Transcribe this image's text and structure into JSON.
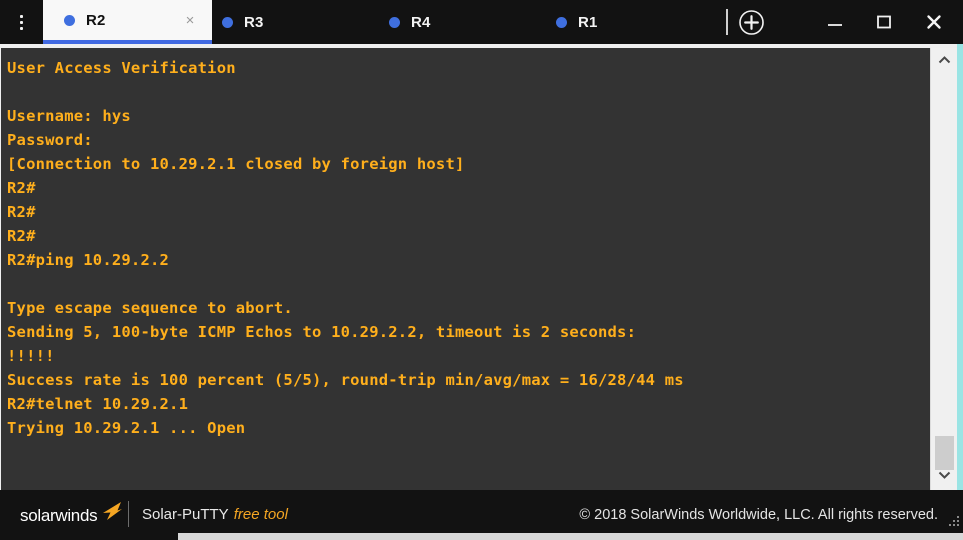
{
  "titlebar": {
    "menu_icon": "kebab-menu-icon",
    "tabs": [
      {
        "label": "R2",
        "active": true,
        "dot_color": "#3f6fdf",
        "close_glyph": "×"
      },
      {
        "label": "R3",
        "active": false,
        "dot_color": "#3f6fdf"
      },
      {
        "label": "R4",
        "active": false,
        "dot_color": "#3f6fdf"
      },
      {
        "label": "R1",
        "active": false,
        "dot_color": "#3f6fdf"
      }
    ],
    "add_tab_icon": "plus-circle-icon",
    "window_controls": {
      "minimize": "minimize-icon",
      "maximize": "maximize-icon",
      "close": "close-icon"
    }
  },
  "terminal": {
    "background": "#333333",
    "text_color": "#ffaf1c",
    "lines": [
      "User Access Verification",
      "",
      "Username: hys",
      "Password:",
      "[Connection to 10.29.2.1 closed by foreign host]",
      "R2#",
      "R2#",
      "R2#",
      "R2#ping 10.29.2.2",
      "",
      "Type escape sequence to abort.",
      "Sending 5, 100-byte ICMP Echos to 10.29.2.2, timeout is 2 seconds:",
      "!!!!!",
      "Success rate is 100 percent (5/5), round-trip min/avg/max = 16/28/44 ms",
      "R2#telnet 10.29.2.1",
      "Trying 10.29.2.1 ... Open"
    ]
  },
  "scrollbar": {
    "up_arrow_icon": "chevron-up-icon",
    "down_arrow_icon": "chevron-down-icon",
    "thumb": "scroll-thumb"
  },
  "footer": {
    "brand_name": "solarwinds",
    "brand_mark_color": "#f5a623",
    "product_name": "Solar-PuTTY",
    "product_tag": "free tool",
    "copyright": "© 2018 SolarWinds Worldwide, LLC. All rights reserved.",
    "resize_grip": "resize-grip-icon"
  }
}
